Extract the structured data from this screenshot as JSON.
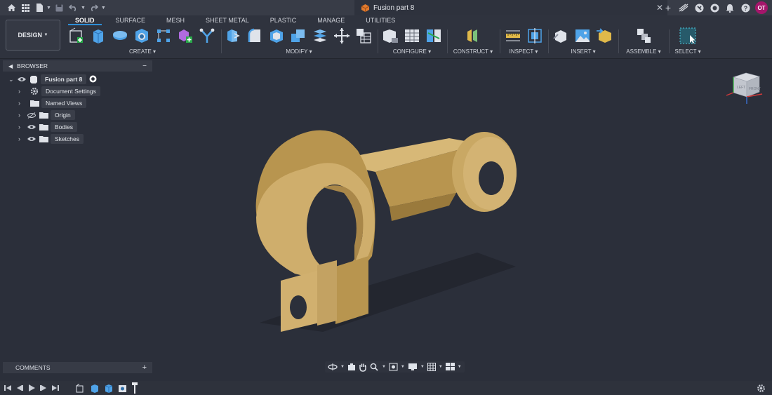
{
  "window": {
    "doc_title": "Fusion part 8",
    "user_initials": "OT"
  },
  "workspace": {
    "mode_label": "DESIGN"
  },
  "tabs": [
    "SOLID",
    "SURFACE",
    "MESH",
    "SHEET METAL",
    "PLASTIC",
    "MANAGE",
    "UTILITIES"
  ],
  "groups": {
    "create": "CREATE",
    "modify": "MODIFY",
    "configure": "CONFIGURE",
    "construct": "CONSTRUCT",
    "inspect": "INSPECT",
    "insert": "INSERT",
    "assemble": "ASSEMBLE",
    "select": "SELECT"
  },
  "browser": {
    "title": "BROWSER",
    "root": "Fusion part 8",
    "items": [
      "Document Settings",
      "Named Views",
      "Origin",
      "Bodies",
      "Sketches"
    ]
  },
  "comments": {
    "title": "COMMENTS"
  },
  "viewcube": {
    "top": "TOP",
    "left": "LEFT",
    "front": "FRONT"
  },
  "colors": {
    "accent": "#2d8ed6",
    "part": "#c9a864",
    "background": "#2b2f3a",
    "avatar": "#a5166b"
  }
}
